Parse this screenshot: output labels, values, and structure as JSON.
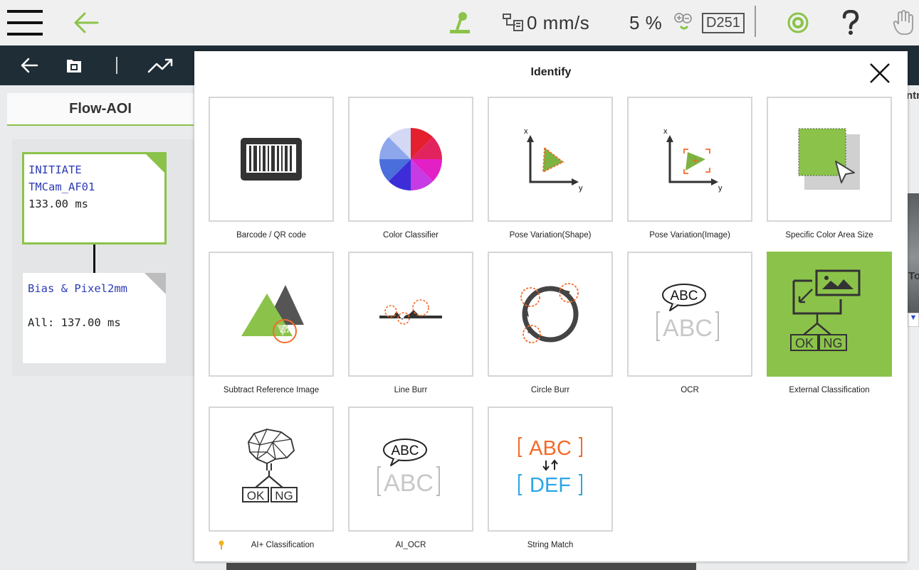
{
  "status_bar": {
    "speed": "0 mm/s",
    "speed_percent": "5 %",
    "program_code": "D251"
  },
  "flow": {
    "tab_title": "Flow-AOI",
    "nodes": [
      {
        "line1": "INITIATE",
        "line2": "TMCam_AF01",
        "line3": "133.00 ms"
      },
      {
        "line1": "Bias & Pixel2mm",
        "line2": "All: 137.00 ms"
      }
    ]
  },
  "right_panel_peek": {
    "label_top": "ntr",
    "label_mid": "To"
  },
  "modal": {
    "title": "Identify",
    "tools": [
      {
        "label": "Barcode / QR code",
        "icon": "barcode-icon"
      },
      {
        "label": "Color Classifier",
        "icon": "color-wheel-icon"
      },
      {
        "label": "Pose Variation(Shape)",
        "icon": "pose-shape-icon"
      },
      {
        "label": "Pose Variation(Image)",
        "icon": "pose-image-icon"
      },
      {
        "label": "Specific Color Area Size",
        "icon": "color-area-icon"
      },
      {
        "label": "Subtract Reference Image",
        "icon": "subtract-image-icon"
      },
      {
        "label": "Line Burr",
        "icon": "line-burr-icon"
      },
      {
        "label": "Circle Burr",
        "icon": "circle-burr-icon"
      },
      {
        "label": "OCR",
        "icon": "ocr-icon"
      },
      {
        "label": "External Classification",
        "icon": "external-classification-icon",
        "selected": true
      },
      {
        "label": "AI+ Classification",
        "icon": "ai-classification-icon"
      },
      {
        "label": "AI_OCR",
        "icon": "ai-ocr-icon"
      },
      {
        "label": "String Match",
        "icon": "string-match-icon"
      }
    ],
    "icon_text": {
      "abc": "ABC",
      "def": "DEF",
      "ok": "OK",
      "ng": "NG",
      "x": "x",
      "y": "y"
    }
  },
  "colors": {
    "accent_green": "#8bc34a",
    "toolbar_dark": "#1f2d36",
    "ocr_orange": "#f26b2a",
    "ocr_blue": "#2aa5e6"
  }
}
